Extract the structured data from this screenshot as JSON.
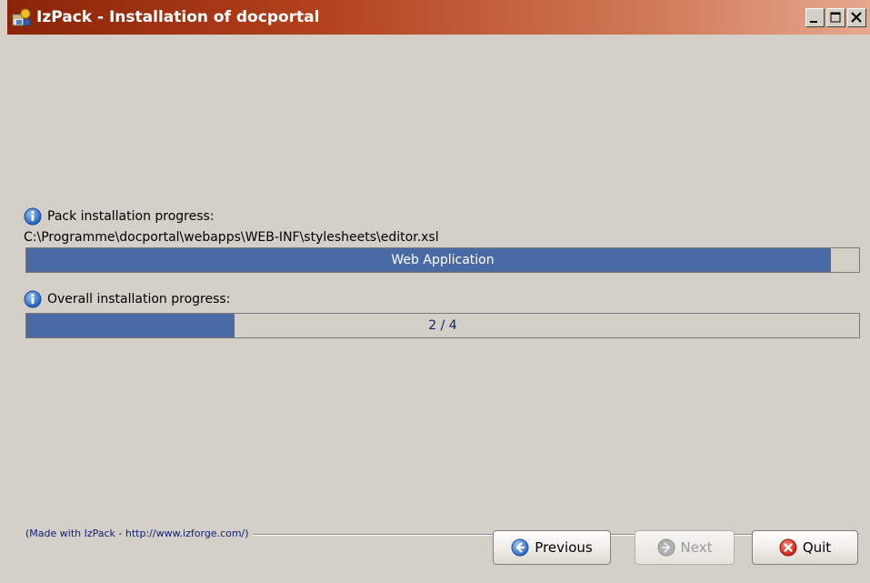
{
  "window": {
    "title": "IzPack - Installation of docportal",
    "controls": {
      "minimize": "minimize-icon",
      "maximize": "maximize-icon",
      "close": "close-icon"
    }
  },
  "pack_progress": {
    "label": "Pack installation progress:",
    "current_file": "C:\\Programme\\docportal\\webapps\\WEB-INF\\stylesheets\\editor.xsl",
    "bar_text": "Web Application",
    "fraction": 0.966
  },
  "overall_progress": {
    "label": "Overall installation progress:",
    "bar_text": "2 / 4",
    "fraction": 0.25
  },
  "footer": {
    "credit": "(Made with IzPack - http://www.izforge.com/)"
  },
  "buttons": {
    "previous": "Previous",
    "next": "Next",
    "quit": "Quit"
  },
  "colors": {
    "titlebar": "#a83a18",
    "progress_fill": "#4a6aa5",
    "dialog_bg": "#d4d0c8"
  }
}
